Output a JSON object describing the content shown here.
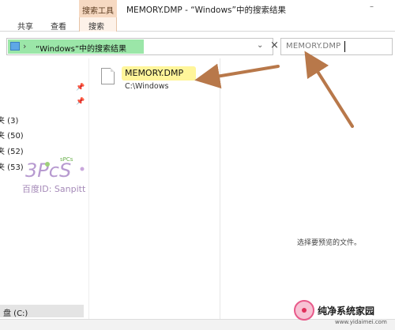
{
  "window": {
    "context_tab": "搜索工具",
    "title": "MEMORY.DMP - “Windows”中的搜索结果",
    "minimize": "–"
  },
  "ribbon": {
    "tabs": [
      "共享",
      "查看",
      "搜索"
    ]
  },
  "address": {
    "path": "“Windows”中的搜索结果"
  },
  "search": {
    "value": "MEMORY.DMP"
  },
  "nav": {
    "items": [
      {
        "label": "夹 (3)"
      },
      {
        "label": "夹 (50)"
      },
      {
        "label": "夹 (52)"
      },
      {
        "label": "夹 (53)"
      }
    ],
    "drive": "盘 (C:)"
  },
  "watermark": {
    "logo_text": "3PcS",
    "logo_sup": "sPCs",
    "caption": "百度ID: Sanpitt"
  },
  "results": {
    "items": [
      {
        "name": "MEMORY.DMP",
        "path": "C:\\Windows",
        "icon": "file-icon"
      }
    ]
  },
  "preview": {
    "message": "选择要预览的文件。"
  },
  "brand": {
    "title": "纯净系统家园",
    "url": "www.yidaimei.com"
  },
  "colors": {
    "context_tab_bg": "#f6d9c2",
    "address_highlight": "#9be6a8",
    "filename_highlight": "#fff59a",
    "arrow": "#b8784a"
  }
}
